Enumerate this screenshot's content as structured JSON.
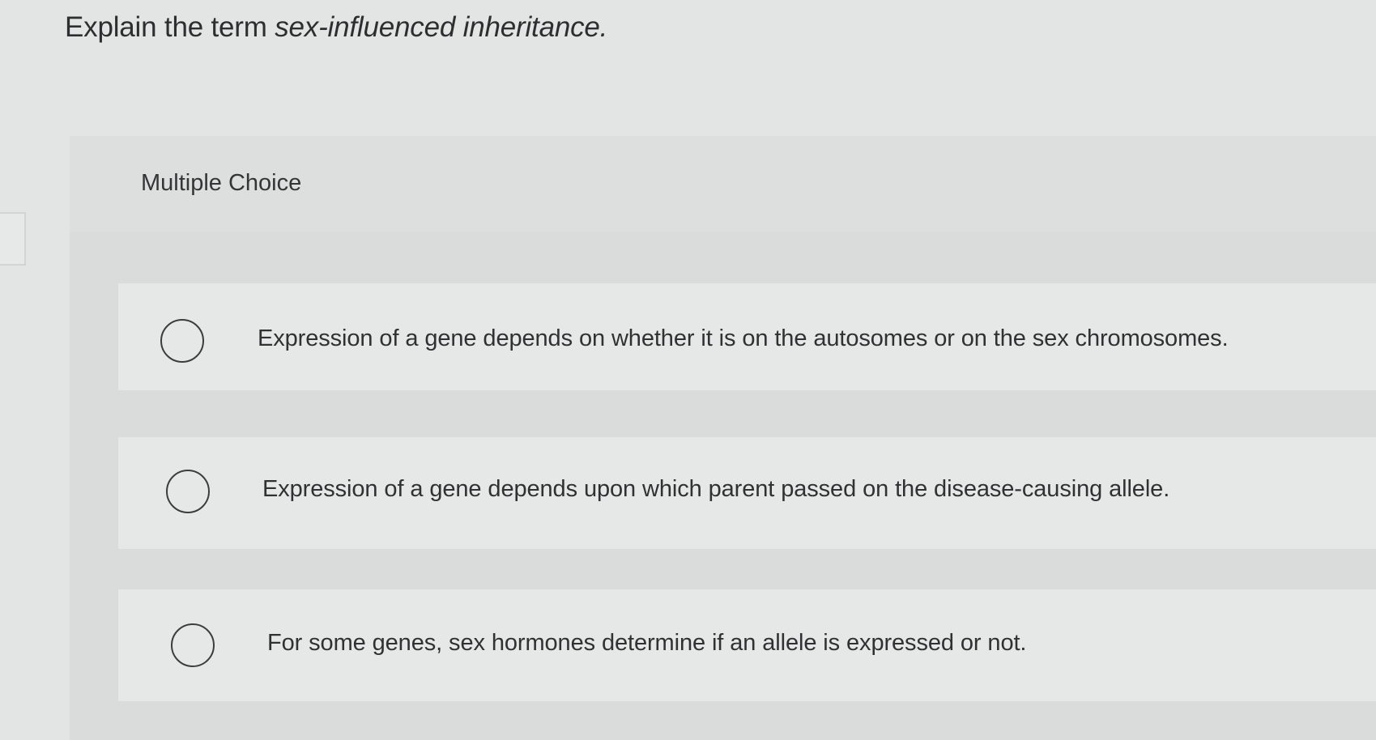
{
  "question": {
    "prefix": "Explain the term ",
    "emphasis": "sex-influenced inheritance."
  },
  "section": {
    "label": "Multiple Choice"
  },
  "options": [
    {
      "text": "Expression of a gene depends on whether it is on the autosomes or on the sex chromosomes.",
      "selected": false
    },
    {
      "text": "Expression of a gene depends upon which parent passed on the disease-causing allele.",
      "selected": false
    },
    {
      "text": "For some genes, sex hormones determine if an allele is expressed or not.",
      "selected": false
    }
  ]
}
